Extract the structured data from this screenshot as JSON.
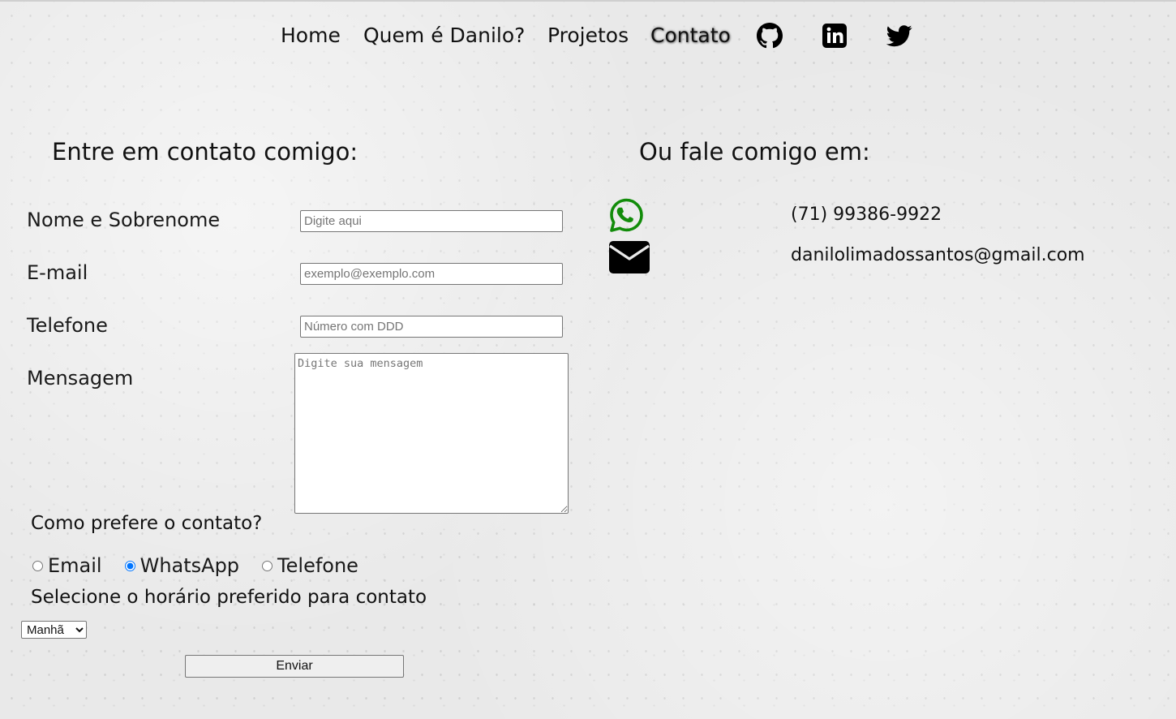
{
  "nav": {
    "links": [
      "Home",
      "Quem é Danilo?",
      "Projetos",
      "Contato"
    ],
    "active": "Contato",
    "social_icons": [
      "github-icon",
      "linkedin-icon",
      "twitter-icon"
    ]
  },
  "form": {
    "heading": "Entre em contato comigo:",
    "name_label": "Nome e Sobrenome",
    "name_placeholder": "Digite aqui",
    "email_label": "E-mail",
    "email_placeholder": "exemplo@exemplo.com",
    "phone_label": "Telefone",
    "phone_placeholder": "Número com DDD",
    "message_label": "Mensagem",
    "message_placeholder": "Digite sua mensagem",
    "preference_heading": "Como prefere o contato?",
    "preference_options": [
      "Email",
      "WhatsApp",
      "Telefone"
    ],
    "preference_selected": "WhatsApp",
    "time_heading": "Selecione o horário preferido para contato",
    "time_selected": "Manhã",
    "submit_label": "Enviar"
  },
  "contact": {
    "heading": "Ou fale comigo em:",
    "whatsapp_icon": "whatsapp-icon",
    "phone": "(71) 99386-9922",
    "email_icon": "envelope-icon",
    "email": "danilolimadossantos@gmail.com"
  },
  "colors": {
    "whatsapp": "#128c0a",
    "text": "#111111",
    "background": "#e9e9e9"
  }
}
